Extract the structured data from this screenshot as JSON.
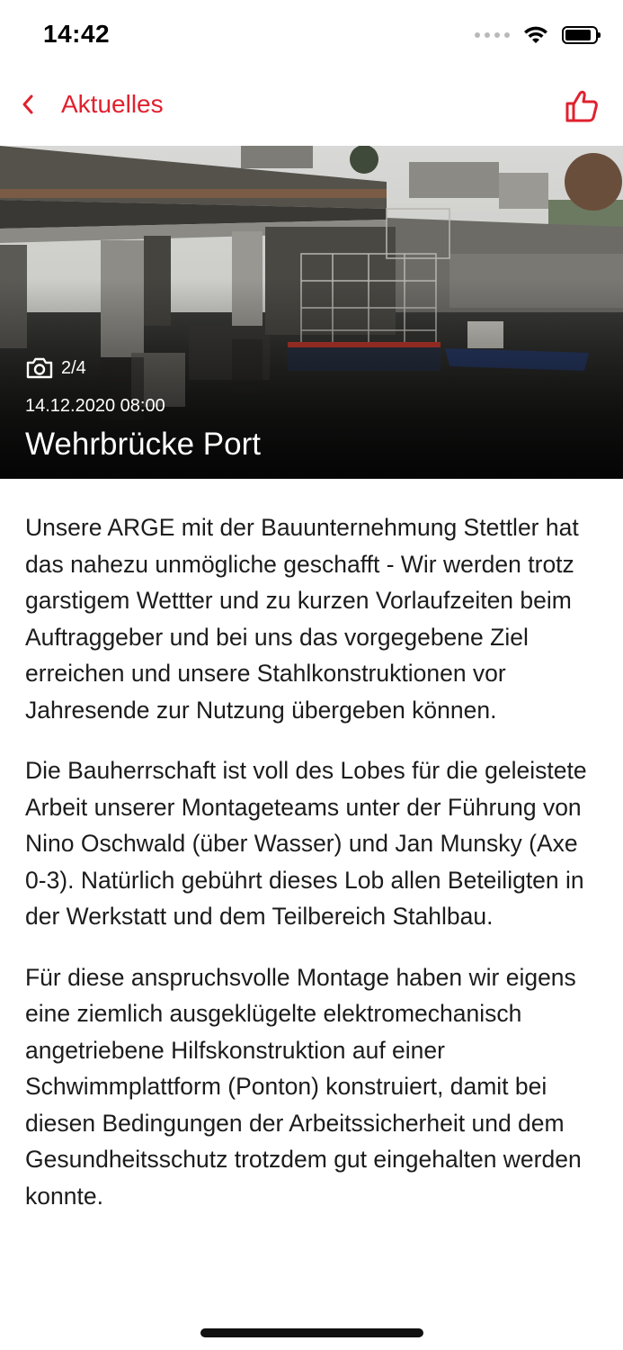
{
  "status_bar": {
    "time": "14:42",
    "icons": [
      "cellular-signal-icon",
      "wifi-icon",
      "battery-icon"
    ]
  },
  "nav": {
    "back_label": "Aktuelles",
    "back_icon": "chevron-left-icon",
    "like_icon": "thumbs-up-icon",
    "accent_color": "#e0212e"
  },
  "hero": {
    "photo_counter": "2/4",
    "camera_icon": "camera-icon",
    "date": "14.12.2020 08:00",
    "title": "Wehrbrücke Port"
  },
  "article": {
    "paragraphs": [
      "Unsere ARGE mit der Bauunternehmung Stettler hat das nahezu unmögliche geschafft - Wir werden trotz garstigem Wettter und zu kurzen Vorlaufzeiten beim Auftraggeber und bei uns das vorgegebene Ziel erreichen und unsere Stahlkonstruktionen vor Jahresende zur Nutzung übergeben können.",
      "Die Bauherrschaft ist voll des Lobes für die geleistete Arbeit unserer Montageteams unter der Führung von Nino Oschwald (über Wasser) und Jan Munsky (Axe 0-3). Natürlich gebührt dieses Lob allen Beteiligten in der Werkstatt und dem Teilbereich Stahlbau.",
      "Für diese anspruchsvolle Montage haben wir eigens eine ziemlich ausgeklügelte elektromechanisch angetriebene Hilfskonstruktion auf einer Schwimmplattform (Ponton) konstruiert, damit bei diesen Bedingungen der Arbeitssicherheit und dem Gesundheitsschutz trotzdem gut eingehalten werden konnte."
    ]
  }
}
